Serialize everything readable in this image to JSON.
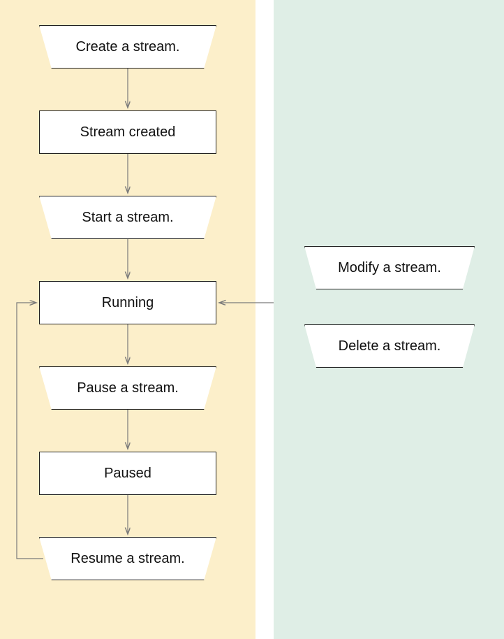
{
  "nodes": {
    "create": {
      "label": "Create a stream."
    },
    "created": {
      "label": "Stream created"
    },
    "start": {
      "label": "Start a stream."
    },
    "running": {
      "label": "Running"
    },
    "pause": {
      "label": "Pause a stream."
    },
    "paused": {
      "label": "Paused"
    },
    "resume": {
      "label": "Resume a stream."
    },
    "modify": {
      "label": "Modify a stream."
    },
    "delete": {
      "label": "Delete a stream."
    }
  },
  "layout": {
    "colors": {
      "left_bg": "#FCEFCA",
      "right_bg": "#DFEEE6",
      "arrow": "#7a7a7a",
      "node_border": "#202020"
    }
  },
  "edges": [
    {
      "from": "create",
      "to": "created",
      "kind": "down"
    },
    {
      "from": "created",
      "to": "start",
      "kind": "down"
    },
    {
      "from": "start",
      "to": "running",
      "kind": "down"
    },
    {
      "from": "running",
      "to": "pause",
      "kind": "down"
    },
    {
      "from": "pause",
      "to": "paused",
      "kind": "down"
    },
    {
      "from": "paused",
      "to": "resume",
      "kind": "down"
    },
    {
      "from": "resume",
      "to": "running",
      "kind": "loop-left"
    },
    {
      "from": "right-panel",
      "to": "running",
      "kind": "left-into"
    }
  ]
}
